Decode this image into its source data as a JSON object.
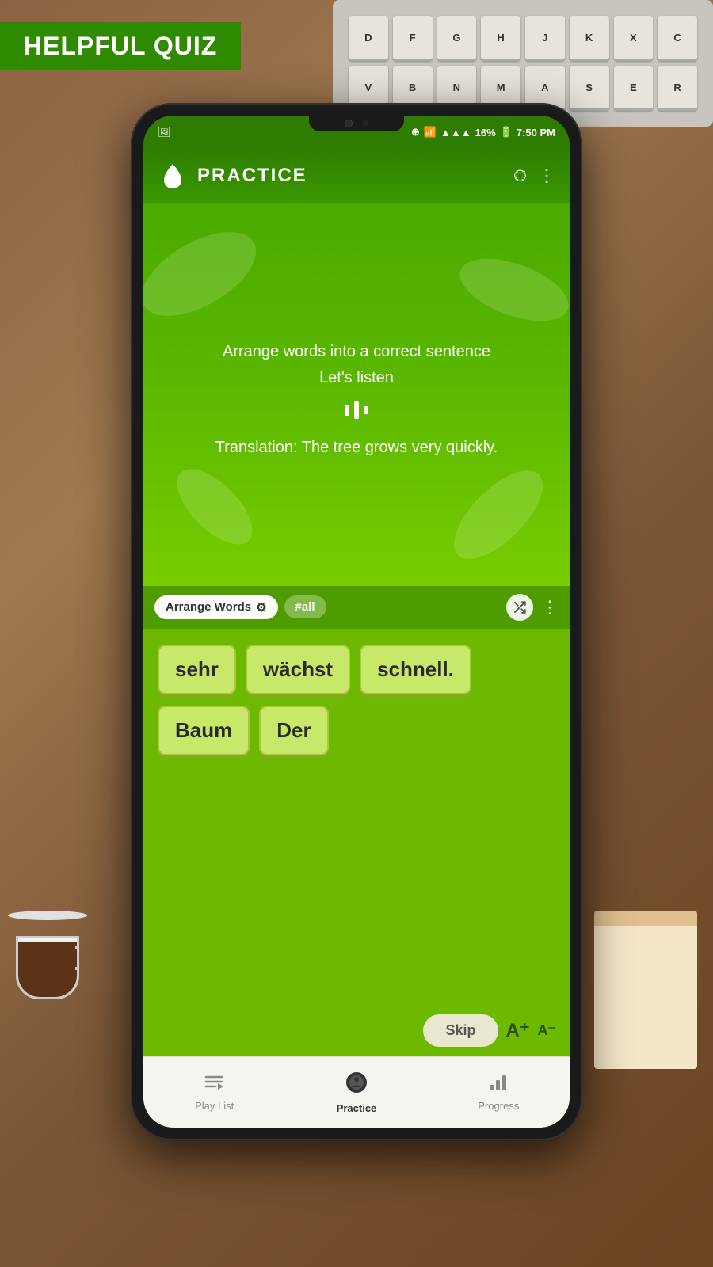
{
  "app": {
    "title": "PRACTICE",
    "banner": "HELPFUL QUIZ"
  },
  "status_bar": {
    "battery": "16%",
    "time": "7:50 PM",
    "signal": "▲▲▲",
    "wifi": "wifi"
  },
  "quiz": {
    "instruction": "Arrange words into a correct sentence",
    "listen_label": "Let's listen",
    "translation": "Translation: The tree grows very quickly."
  },
  "mode": {
    "chip_label": "Arrange Words",
    "tag_label": "#all"
  },
  "words": [
    {
      "text": "sehr"
    },
    {
      "text": "wächst"
    },
    {
      "text": "schnell."
    },
    {
      "text": "Baum"
    },
    {
      "text": "Der"
    }
  ],
  "buttons": {
    "skip": "Skip",
    "font_plus": "A⁺",
    "font_minus": "A⁻"
  },
  "nav": [
    {
      "label": "Play List",
      "icon": "☰",
      "active": false
    },
    {
      "label": "Practice",
      "icon": "⚙",
      "active": true
    },
    {
      "label": "Progress",
      "icon": "▲",
      "active": false
    }
  ],
  "keyboard_keys": [
    "D",
    "F",
    "G",
    "H",
    "J",
    "K",
    "X",
    "C",
    "V",
    "B",
    "N",
    "M",
    "A",
    "S",
    "E",
    "R"
  ]
}
